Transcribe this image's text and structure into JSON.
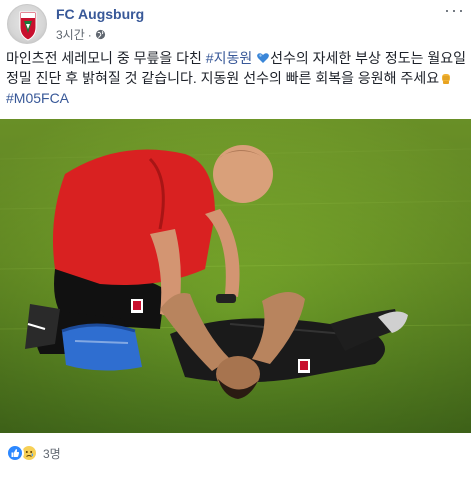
{
  "post": {
    "page_name": "FC Augsburg",
    "timestamp": "3시간",
    "separator": "·",
    "privacy_icon": "globe-icon",
    "more_icon": "more-options-icon",
    "text_before": "마인츠전 세레모니 중 무릎을 다친 ",
    "hashtag_player": "#지동원",
    "text_middle": "선수의 자세한 부상 정도는 월요일 정밀 진단 후 밝혀질 것 같습니다. 지동원 선수의 빠른 회복을 응원해 주세요",
    "hashtag_match": "#M05FCA",
    "inline_emoji_1": "blue-heart-emoji",
    "inline_emoji_2": "fist-emoji"
  },
  "reactions": {
    "icons": [
      "like-icon",
      "sad-icon"
    ],
    "count": "3명"
  },
  "colors": {
    "link": "#385898",
    "text": "#1d2129",
    "meta": "#606770",
    "like": "#2d88ff",
    "sad": "#f7d056",
    "club_red": "#c8102e",
    "grass": "#6a9a2a"
  }
}
